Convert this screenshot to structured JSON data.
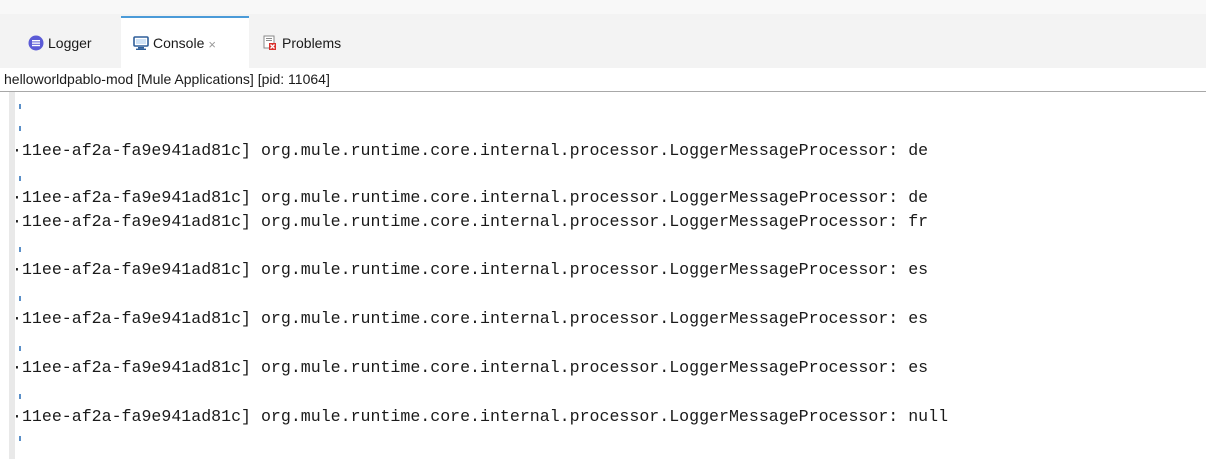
{
  "tabs": {
    "logger": {
      "label": "Logger",
      "icon": "logger-icon"
    },
    "console": {
      "label": "Console",
      "icon": "console-icon",
      "close": "×"
    },
    "problems": {
      "label": "Problems",
      "icon": "problems-icon"
    }
  },
  "console_title": "helloworldpablo-mod [Mule Applications]  [pid: 11064]",
  "log_lines": [
    "·11ee-af2a-fa9e941ad81c] org.mule.runtime.core.internal.processor.LoggerMessageProcessor: de",
    "·11ee-af2a-fa9e941ad81c] org.mule.runtime.core.internal.processor.LoggerMessageProcessor: de",
    "·11ee-af2a-fa9e941ad81c] org.mule.runtime.core.internal.processor.LoggerMessageProcessor: fr",
    "·11ee-af2a-fa9e941ad81c] org.mule.runtime.core.internal.processor.LoggerMessageProcessor: es",
    "·11ee-af2a-fa9e941ad81c] org.mule.runtime.core.internal.processor.LoggerMessageProcessor: es",
    "·11ee-af2a-fa9e941ad81c] org.mule.runtime.core.internal.processor.LoggerMessageProcessor: es",
    "·11ee-af2a-fa9e941ad81c] org.mule.runtime.core.internal.processor.LoggerMessageProcessor: null"
  ],
  "colors": {
    "accent": "#4b9bd8",
    "logger_icon": "#5b5bd6",
    "problems_red": "#d9302c"
  }
}
